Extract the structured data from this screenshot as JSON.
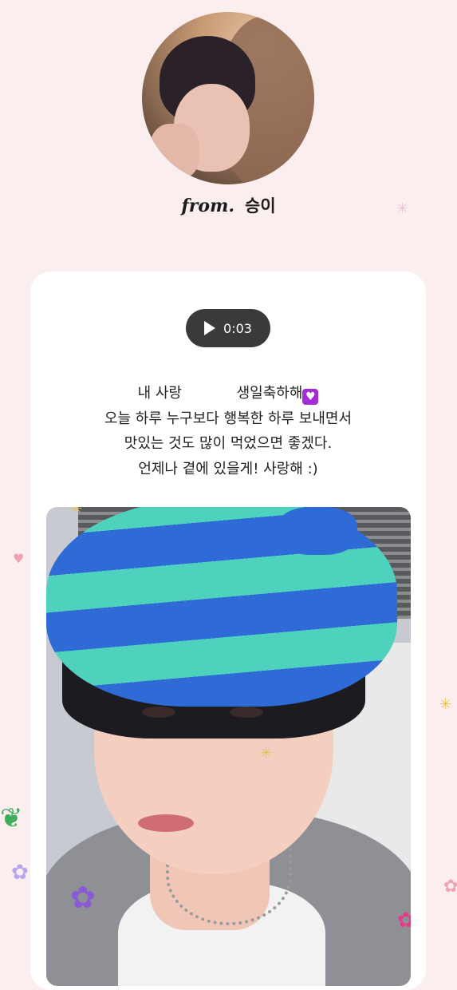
{
  "profile": {
    "from_label": "from.",
    "sender_name": "승이"
  },
  "audio": {
    "duration": "0:03"
  },
  "message": {
    "line1_start": "내 사랑            생일축하해",
    "line1_emoji": "♥",
    "line2": "오늘 하루 누구보다 행복한 하루 보내면서",
    "line3": "맛있는 것도 많이 먹었으면 좋겠다.",
    "line4": "언제나 곁에 있을게! 사랑해 :)"
  },
  "colors": {
    "background": "#fbeeee",
    "card": "#ffffff",
    "audio_pill": "#3a3a3a",
    "heart_emoji_bg": "#a42bd6"
  },
  "icons": [
    "play-icon",
    "sparkle-icon",
    "heart-icon",
    "flower-icon",
    "leaf-icon"
  ]
}
